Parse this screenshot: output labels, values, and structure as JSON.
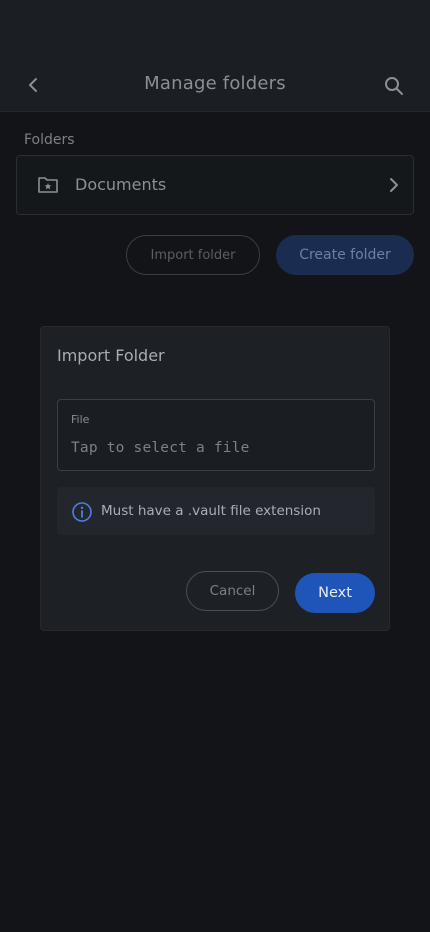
{
  "header": {
    "title": "Manage folders",
    "back_icon": "chevron-left-icon",
    "search_icon": "search-icon"
  },
  "folders": {
    "section_label": "Folders",
    "items": [
      {
        "name": "Documents",
        "icon": "folder-star-icon"
      }
    ]
  },
  "actions": {
    "import_label": "Import folder",
    "create_label": "Create folder"
  },
  "dialog": {
    "title": "Import Folder",
    "file_label": "File",
    "file_placeholder": "Tap to select a file",
    "info_text": "Must have a .vault file extension",
    "cancel_label": "Cancel",
    "next_label": "Next"
  },
  "colors": {
    "background": "#121417",
    "dialog": "#1d2024",
    "accent": "#1f55b8"
  }
}
